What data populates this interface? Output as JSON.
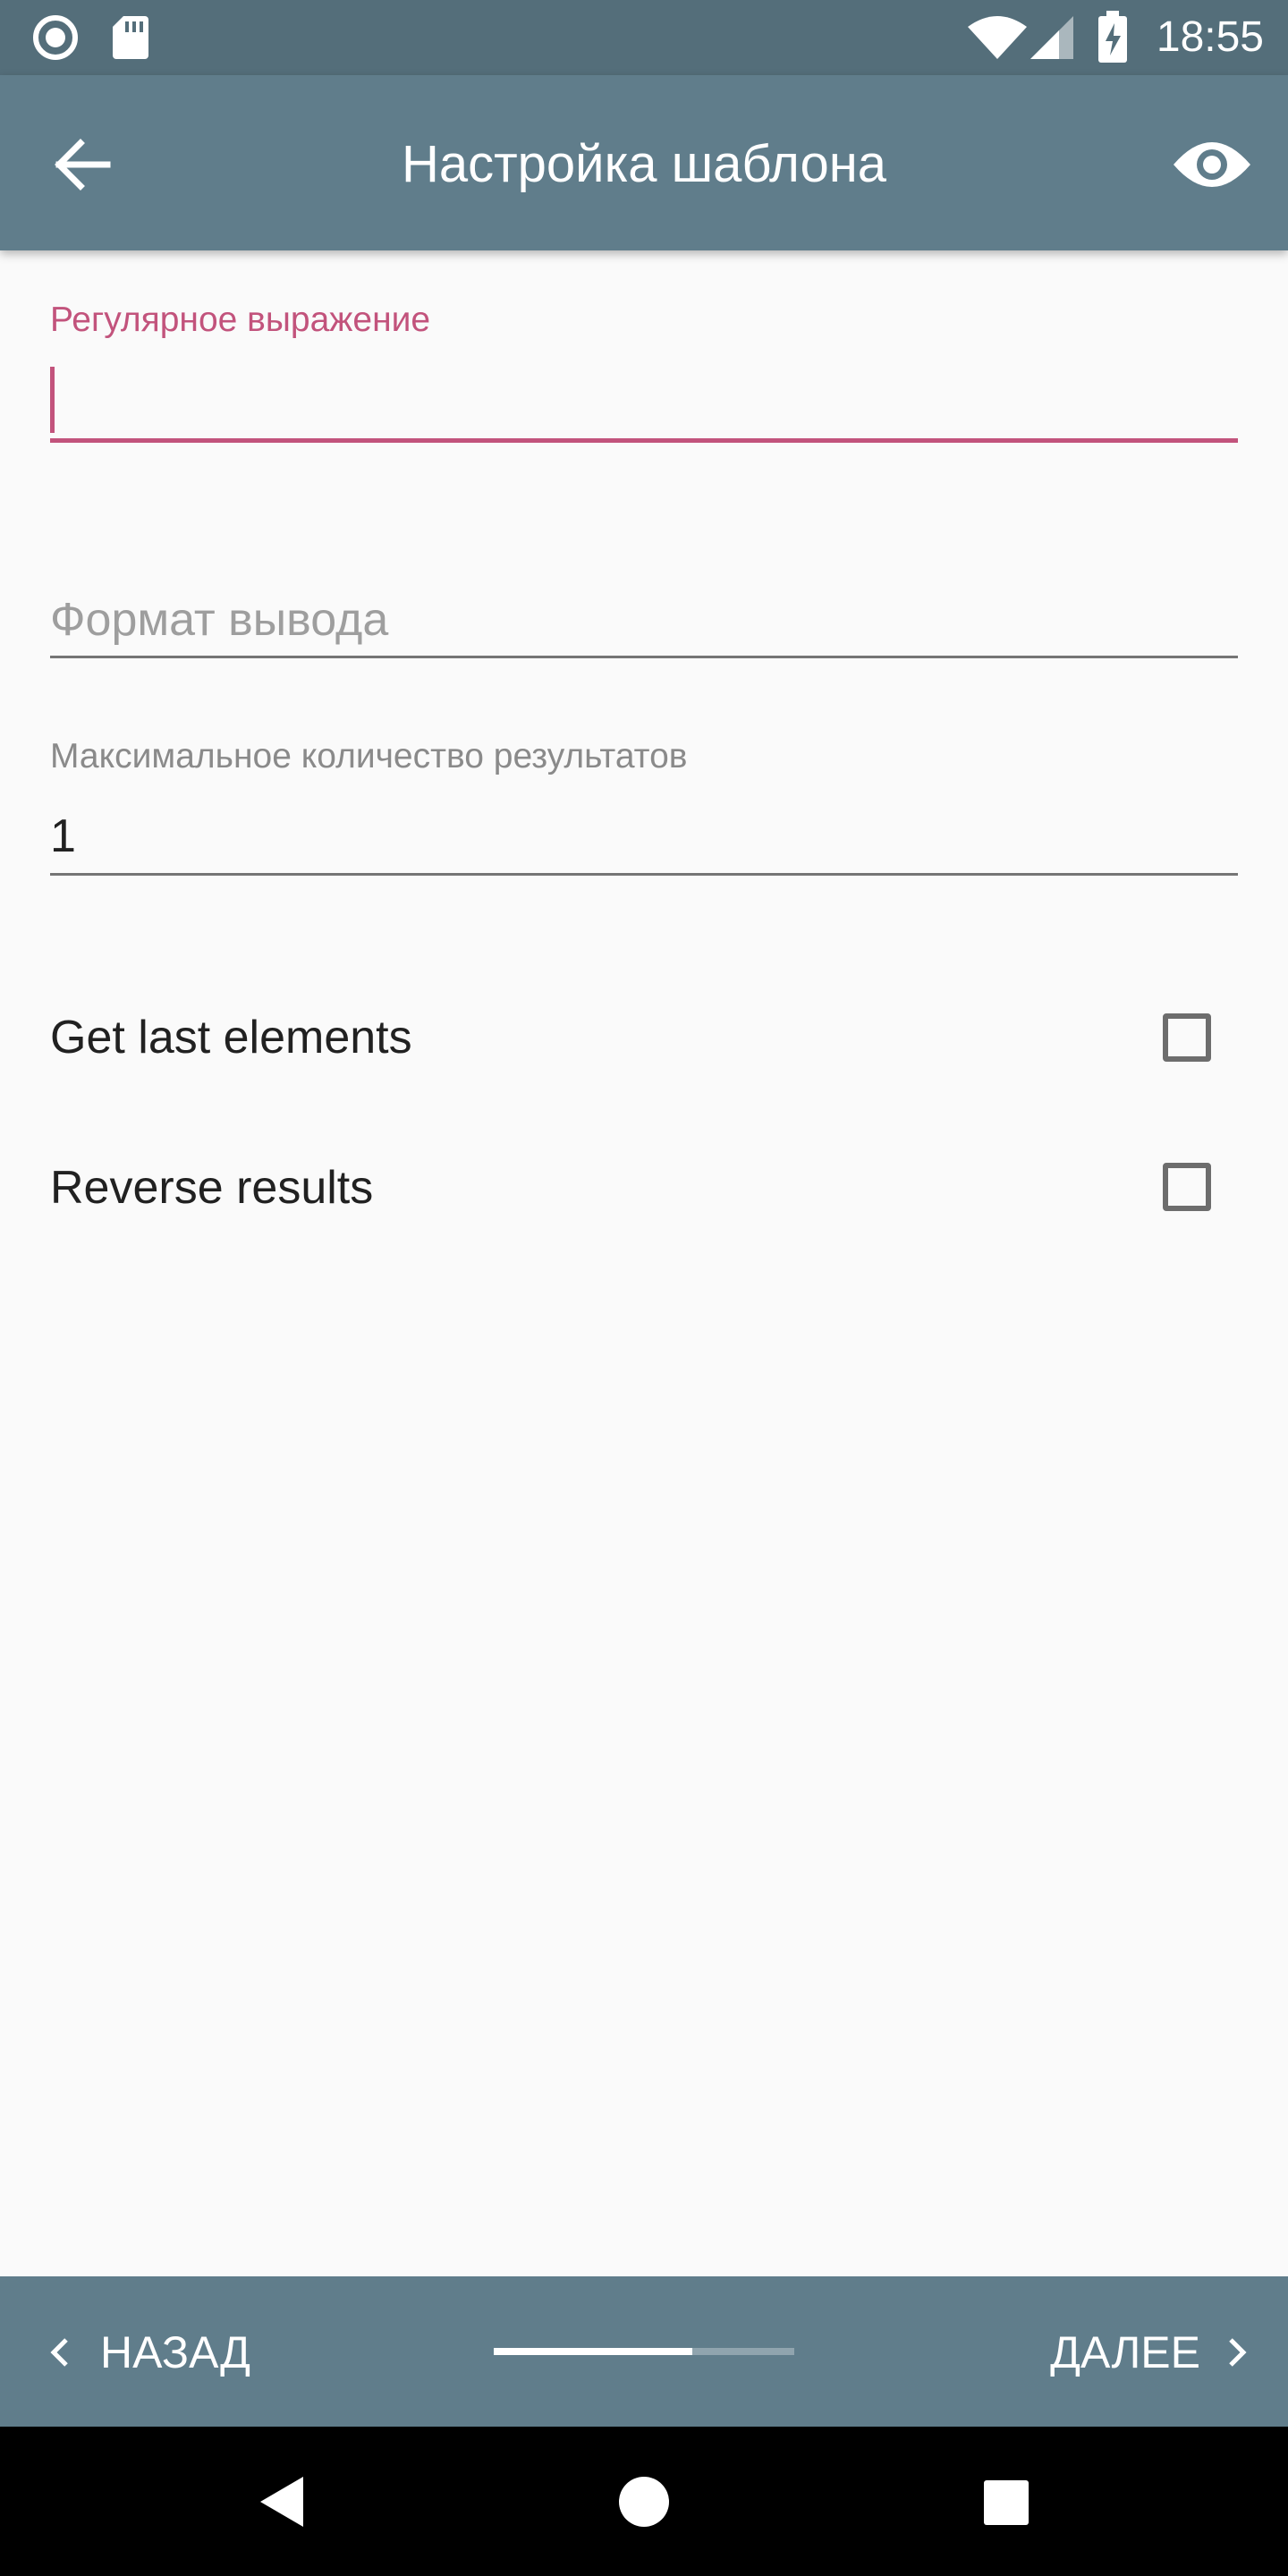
{
  "status_bar": {
    "time": "18:55",
    "icons": [
      "record-icon",
      "sd-card-icon",
      "wifi-icon",
      "signal-icon",
      "battery-charging-icon"
    ]
  },
  "app_bar": {
    "title": "Настройка шаблона",
    "back_icon": "arrow-back-icon",
    "preview_icon": "eye-icon"
  },
  "form": {
    "regex": {
      "label": "Регулярное выражение",
      "value": ""
    },
    "output_format": {
      "placeholder": "Формат вывода",
      "value": ""
    },
    "max_results": {
      "label": "Максимальное количество результатов",
      "value": "1"
    },
    "options": [
      {
        "label": "Get last elements",
        "checked": false
      },
      {
        "label": "Reverse results",
        "checked": false
      }
    ]
  },
  "stepper": {
    "back_label": "НАЗАД",
    "next_label": "ДАЛЕЕ",
    "progress": 0.66
  },
  "nav_bar": {
    "icons": [
      "back-triangle-icon",
      "home-circle-icon",
      "recents-square-icon"
    ]
  },
  "colors": {
    "status_bar": "#546E7A",
    "app_bar": "#607D8B",
    "accent": "#C2537C",
    "background": "#FAFAFA"
  }
}
